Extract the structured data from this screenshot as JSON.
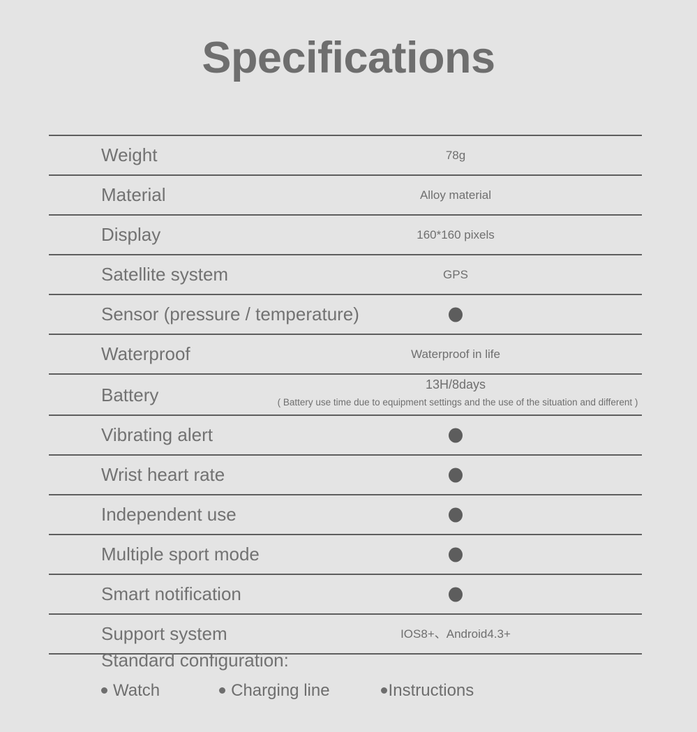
{
  "page": {
    "title": "Specifications",
    "background_color": "#e4e4e4",
    "title_color": "#6e6e6e",
    "label_color": "#727272",
    "value_color": "#6f6f6f",
    "rule_color": "#5e5e5e",
    "dot_color": "#5d5d5d"
  },
  "table": {
    "rows": [
      {
        "label": "Weight",
        "value": "78g",
        "type": "text"
      },
      {
        "label": "Material",
        "value": "Alloy material",
        "type": "text"
      },
      {
        "label": "Display",
        "value": "160*160 pixels",
        "type": "text"
      },
      {
        "label": "Satellite system",
        "value": "GPS",
        "type": "text"
      },
      {
        "label": "Sensor (pressure / temperature)",
        "value": "",
        "type": "dot",
        "marker": "filled-dot"
      },
      {
        "label": "Waterproof",
        "value": "Waterproof in life",
        "type": "text"
      },
      {
        "label": "Battery",
        "value": "13H/8days",
        "note": "( Battery use time due to equipment settings and the use of the situation and different )",
        "type": "text-with-note"
      },
      {
        "label": "Vibrating alert",
        "value": "",
        "type": "dot",
        "marker": "filled-dot"
      },
      {
        "label": "Wrist heart rate",
        "value": "",
        "type": "dot",
        "marker": "filled-dot"
      },
      {
        "label": "Independent use",
        "value": "",
        "type": "dot",
        "marker": "filled-dot"
      },
      {
        "label": "Multiple sport mode",
        "value": "",
        "type": "dot",
        "marker": "filled-dot"
      },
      {
        "label": "Smart notification",
        "value": "",
        "type": "dot",
        "marker": "filled-dot"
      },
      {
        "label": "Support system",
        "value": "IOS8+、Android4.3+",
        "type": "text"
      }
    ]
  },
  "standard_configuration": {
    "heading": "Standard configuration:",
    "items": [
      {
        "label": "Watch"
      },
      {
        "label": "Charging line"
      },
      {
        "label": "Instructions"
      }
    ]
  }
}
